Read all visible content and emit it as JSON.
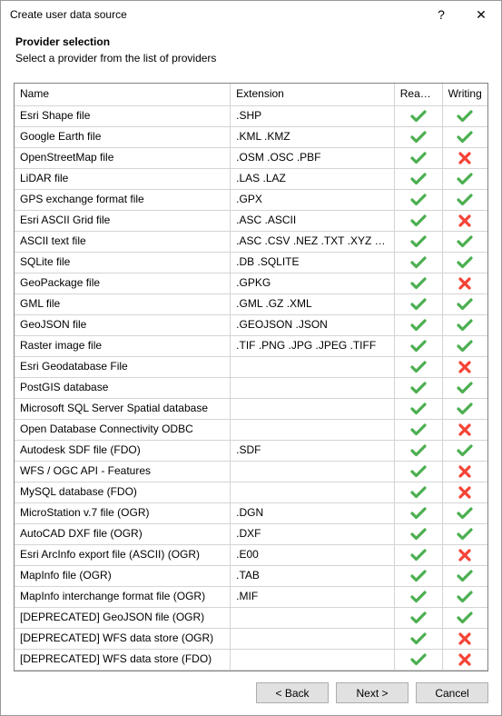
{
  "window": {
    "title": "Create user data source",
    "help_label": "?",
    "close_label": "✕"
  },
  "header": {
    "title": "Provider selection",
    "subtitle": "Select a provider from the list of providers"
  },
  "columns": {
    "name": "Name",
    "extension": "Extension",
    "reading": "Reading",
    "writing": "Writing"
  },
  "icons": {
    "check_color": "#4caf50",
    "cross_color": "#f44336"
  },
  "rows": [
    {
      "name": "Esri Shape file",
      "ext": ".SHP",
      "read": true,
      "write": true
    },
    {
      "name": "Google Earth file",
      "ext": ".KML .KMZ",
      "read": true,
      "write": true
    },
    {
      "name": "OpenStreetMap file",
      "ext": ".OSM .OSC .PBF",
      "read": true,
      "write": false
    },
    {
      "name": "LiDAR file",
      "ext": ".LAS .LAZ",
      "read": true,
      "write": true
    },
    {
      "name": "GPS exchange format file",
      "ext": ".GPX",
      "read": true,
      "write": true
    },
    {
      "name": "Esri ASCII Grid file",
      "ext": ".ASC .ASCII",
      "read": true,
      "write": false
    },
    {
      "name": "ASCII text file",
      "ext": ".ASC .CSV .NEZ .TXT .XYZ .UPT",
      "read": true,
      "write": true
    },
    {
      "name": "SQLite file",
      "ext": ".DB .SQLITE",
      "read": true,
      "write": true
    },
    {
      "name": "GeoPackage file",
      "ext": ".GPKG",
      "read": true,
      "write": false
    },
    {
      "name": "GML file",
      "ext": ".GML .GZ .XML",
      "read": true,
      "write": true
    },
    {
      "name": "GeoJSON file",
      "ext": ".GEOJSON .JSON",
      "read": true,
      "write": true
    },
    {
      "name": "Raster image file",
      "ext": ".TIF .PNG .JPG .JPEG .TIFF",
      "read": true,
      "write": true
    },
    {
      "name": "Esri Geodatabase File",
      "ext": "",
      "read": true,
      "write": false
    },
    {
      "name": "PostGIS database",
      "ext": "",
      "read": true,
      "write": true
    },
    {
      "name": "Microsoft SQL Server Spatial database",
      "ext": "",
      "read": true,
      "write": true
    },
    {
      "name": "Open Database Connectivity ODBC",
      "ext": "",
      "read": true,
      "write": false
    },
    {
      "name": "Autodesk SDF file (FDO)",
      "ext": ".SDF",
      "read": true,
      "write": true
    },
    {
      "name": "WFS / OGC API - Features",
      "ext": "",
      "read": true,
      "write": false
    },
    {
      "name": "MySQL database (FDO)",
      "ext": "",
      "read": true,
      "write": false
    },
    {
      "name": "MicroStation v.7 file (OGR)",
      "ext": ".DGN",
      "read": true,
      "write": true
    },
    {
      "name": "AutoCAD DXF file (OGR)",
      "ext": ".DXF",
      "read": true,
      "write": true
    },
    {
      "name": "Esri ArcInfo export file (ASCII) (OGR)",
      "ext": ".E00",
      "read": true,
      "write": false
    },
    {
      "name": "MapInfo file (OGR)",
      "ext": ".TAB",
      "read": true,
      "write": true
    },
    {
      "name": "MapInfo interchange format file (OGR)",
      "ext": ".MIF",
      "read": true,
      "write": true
    },
    {
      "name": "[DEPRECATED] GeoJSON file (OGR)",
      "ext": "",
      "read": true,
      "write": true
    },
    {
      "name": "[DEPRECATED] WFS data store (OGR)",
      "ext": "",
      "read": true,
      "write": false
    },
    {
      "name": "[DEPRECATED] WFS data store (FDO)",
      "ext": "",
      "read": true,
      "write": false
    }
  ],
  "buttons": {
    "back": "< Back",
    "next": "Next >",
    "cancel": "Cancel"
  },
  "col_widths": {
    "name": 229,
    "ext": 174,
    "read": 51,
    "write": 48
  }
}
